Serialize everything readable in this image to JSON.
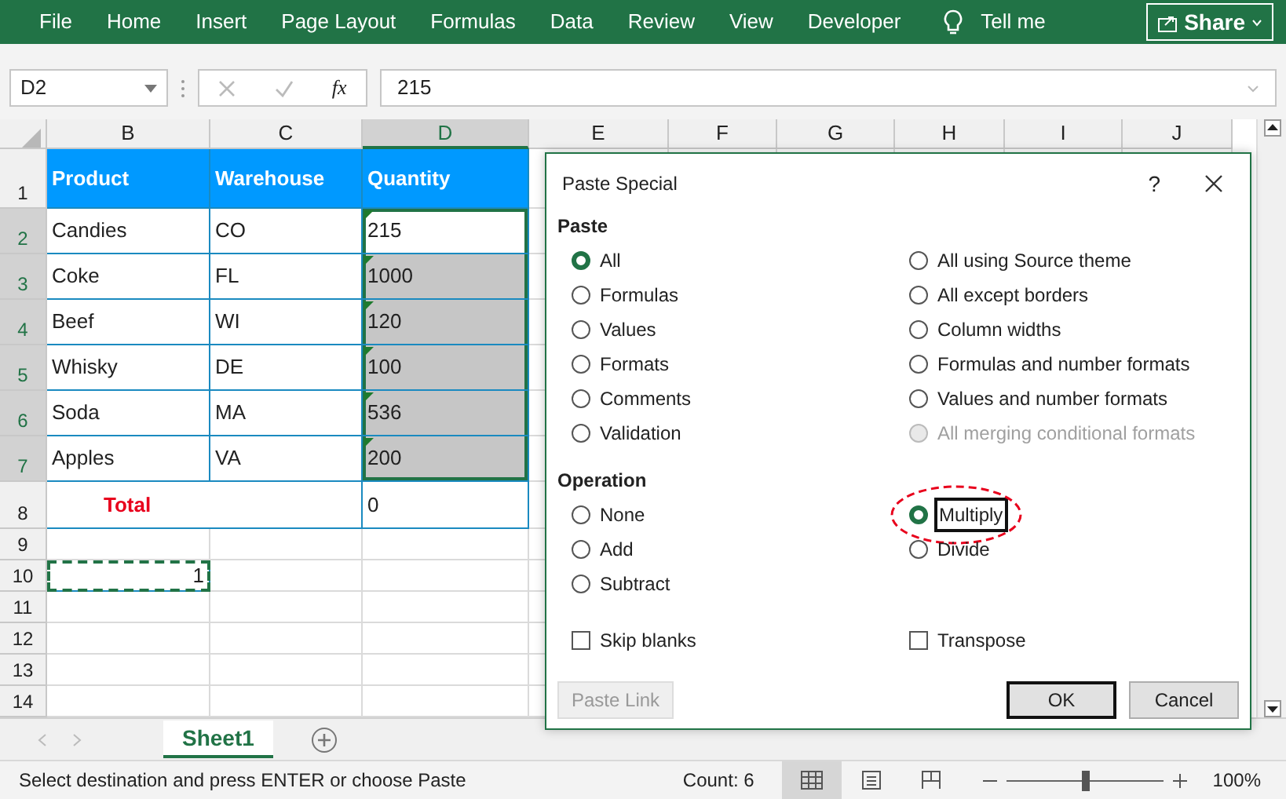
{
  "ribbon": {
    "tabs": [
      {
        "label": "File",
        "selected": false
      },
      {
        "label": "Home",
        "selected": false
      },
      {
        "label": "Insert",
        "selected": false
      },
      {
        "label": "Page Layout",
        "selected": false
      },
      {
        "label": "Formulas",
        "selected": false
      },
      {
        "label": "Data",
        "selected": false
      },
      {
        "label": "Review",
        "selected": false
      },
      {
        "label": "View",
        "selected": false
      },
      {
        "label": "Developer",
        "selected": false
      }
    ],
    "tell_me": "Tell me",
    "share": "Share"
  },
  "formula_bar": {
    "name_box": "D2",
    "function_label": "fx",
    "formula": "215"
  },
  "sheet": {
    "columns": [
      {
        "label": "B",
        "selected": false
      },
      {
        "label": "C",
        "selected": false
      },
      {
        "label": "D",
        "selected": true
      },
      {
        "label": "E",
        "selected": false
      },
      {
        "label": "F",
        "selected": false
      },
      {
        "label": "G",
        "selected": false
      },
      {
        "label": "H",
        "selected": false
      },
      {
        "label": "I",
        "selected": false
      },
      {
        "label": "J",
        "selected": false
      }
    ],
    "rows": [
      {
        "header": "1",
        "selected": false,
        "cells": [
          {
            "text": "Product",
            "kind": "heading"
          },
          {
            "text": "Warehouse",
            "kind": "heading"
          },
          {
            "text": "Quantity",
            "kind": "heading"
          }
        ]
      },
      {
        "header": "2",
        "selected": true,
        "cells": [
          {
            "text": "Candies",
            "kind": "text"
          },
          {
            "text": "CO",
            "kind": "text"
          },
          {
            "text": "215",
            "kind": "text",
            "flagged": true,
            "active": true,
            "selected": false
          }
        ]
      },
      {
        "header": "3",
        "selected": true,
        "cells": [
          {
            "text": "Coke",
            "kind": "text"
          },
          {
            "text": "FL",
            "kind": "text"
          },
          {
            "text": "1000",
            "kind": "text",
            "flagged": true,
            "selected": true
          }
        ]
      },
      {
        "header": "4",
        "selected": true,
        "cells": [
          {
            "text": "Beef",
            "kind": "text"
          },
          {
            "text": "WI",
            "kind": "text"
          },
          {
            "text": "120",
            "kind": "text",
            "flagged": true,
            "selected": true
          }
        ]
      },
      {
        "header": "5",
        "selected": true,
        "cells": [
          {
            "text": "Whisky",
            "kind": "text"
          },
          {
            "text": "DE",
            "kind": "text"
          },
          {
            "text": "100",
            "kind": "text",
            "flagged": true,
            "selected": true
          }
        ]
      },
      {
        "header": "6",
        "selected": true,
        "cells": [
          {
            "text": "Soda",
            "kind": "text"
          },
          {
            "text": "MA",
            "kind": "text"
          },
          {
            "text": "536",
            "kind": "text",
            "flagged": true,
            "selected": true
          }
        ]
      },
      {
        "header": "7",
        "selected": true,
        "cells": [
          {
            "text": "Apples",
            "kind": "text"
          },
          {
            "text": "VA",
            "kind": "text"
          },
          {
            "text": "200",
            "kind": "text",
            "flagged": true,
            "selected": true
          }
        ]
      },
      {
        "header": "8",
        "selected": false,
        "cells": [
          {
            "text": "Total",
            "kind": "total"
          },
          {
            "text": "",
            "kind": "merged"
          },
          {
            "text": "0",
            "kind": "text"
          }
        ]
      },
      {
        "header": "9",
        "selected": false,
        "cells": []
      },
      {
        "header": "10",
        "selected": false,
        "cells": [
          {
            "text": "1",
            "kind": "number",
            "copied": true
          }
        ]
      },
      {
        "header": "11",
        "selected": false,
        "cells": []
      },
      {
        "header": "12",
        "selected": false,
        "cells": []
      },
      {
        "header": "13",
        "selected": false,
        "cells": []
      },
      {
        "header": "14",
        "selected": false,
        "cells": []
      }
    ]
  },
  "sheet_tabs": [
    {
      "label": "Sheet1",
      "selected": true
    }
  ],
  "dialog": {
    "title": "Paste Special",
    "help": "?",
    "paste_label": "Paste",
    "paste_options": [
      {
        "label": "All",
        "selected": true,
        "disabled": false
      },
      {
        "label": "Formulas",
        "selected": false,
        "disabled": false
      },
      {
        "label": "Values",
        "selected": false,
        "disabled": false
      },
      {
        "label": "Formats",
        "selected": false,
        "disabled": false
      },
      {
        "label": "Comments",
        "selected": false,
        "disabled": false
      },
      {
        "label": "Validation",
        "selected": false,
        "disabled": false
      },
      {
        "label": "All using Source theme",
        "selected": false,
        "disabled": false
      },
      {
        "label": "All except borders",
        "selected": false,
        "disabled": false
      },
      {
        "label": "Column widths",
        "selected": false,
        "disabled": false
      },
      {
        "label": "Formulas and number formats",
        "selected": false,
        "disabled": false
      },
      {
        "label": "Values and number formats",
        "selected": false,
        "disabled": false
      },
      {
        "label": "All merging conditional formats",
        "selected": false,
        "disabled": true
      }
    ],
    "operation_label": "Operation",
    "operations": [
      {
        "label": "None",
        "selected": false,
        "focused": false,
        "circled": false
      },
      {
        "label": "Add",
        "selected": false,
        "focused": false,
        "circled": false
      },
      {
        "label": "Subtract",
        "selected": false,
        "focused": false,
        "circled": false
      },
      {
        "label": "Multiply",
        "selected": true,
        "focused": true,
        "circled": true
      },
      {
        "label": "Divide",
        "selected": false,
        "focused": false,
        "circled": false
      }
    ],
    "checkboxes": [
      {
        "label": "Skip blanks",
        "checked": false
      },
      {
        "label": "Transpose",
        "checked": false
      }
    ],
    "buttons": [
      {
        "label": "Paste Link",
        "disabled": true,
        "default": false
      },
      {
        "label": "OK",
        "disabled": false,
        "default": true
      },
      {
        "label": "Cancel",
        "disabled": false,
        "default": false
      }
    ]
  },
  "status_bar": {
    "message": "Select destination and press ENTER or choose Paste",
    "count": "Count: 6",
    "views": [
      {
        "kind": "normal",
        "selected": true
      },
      {
        "kind": "page-layout",
        "selected": false
      },
      {
        "kind": "page-break",
        "selected": false
      }
    ],
    "zoom": {
      "level": 0.5,
      "reading": "100%"
    }
  }
}
